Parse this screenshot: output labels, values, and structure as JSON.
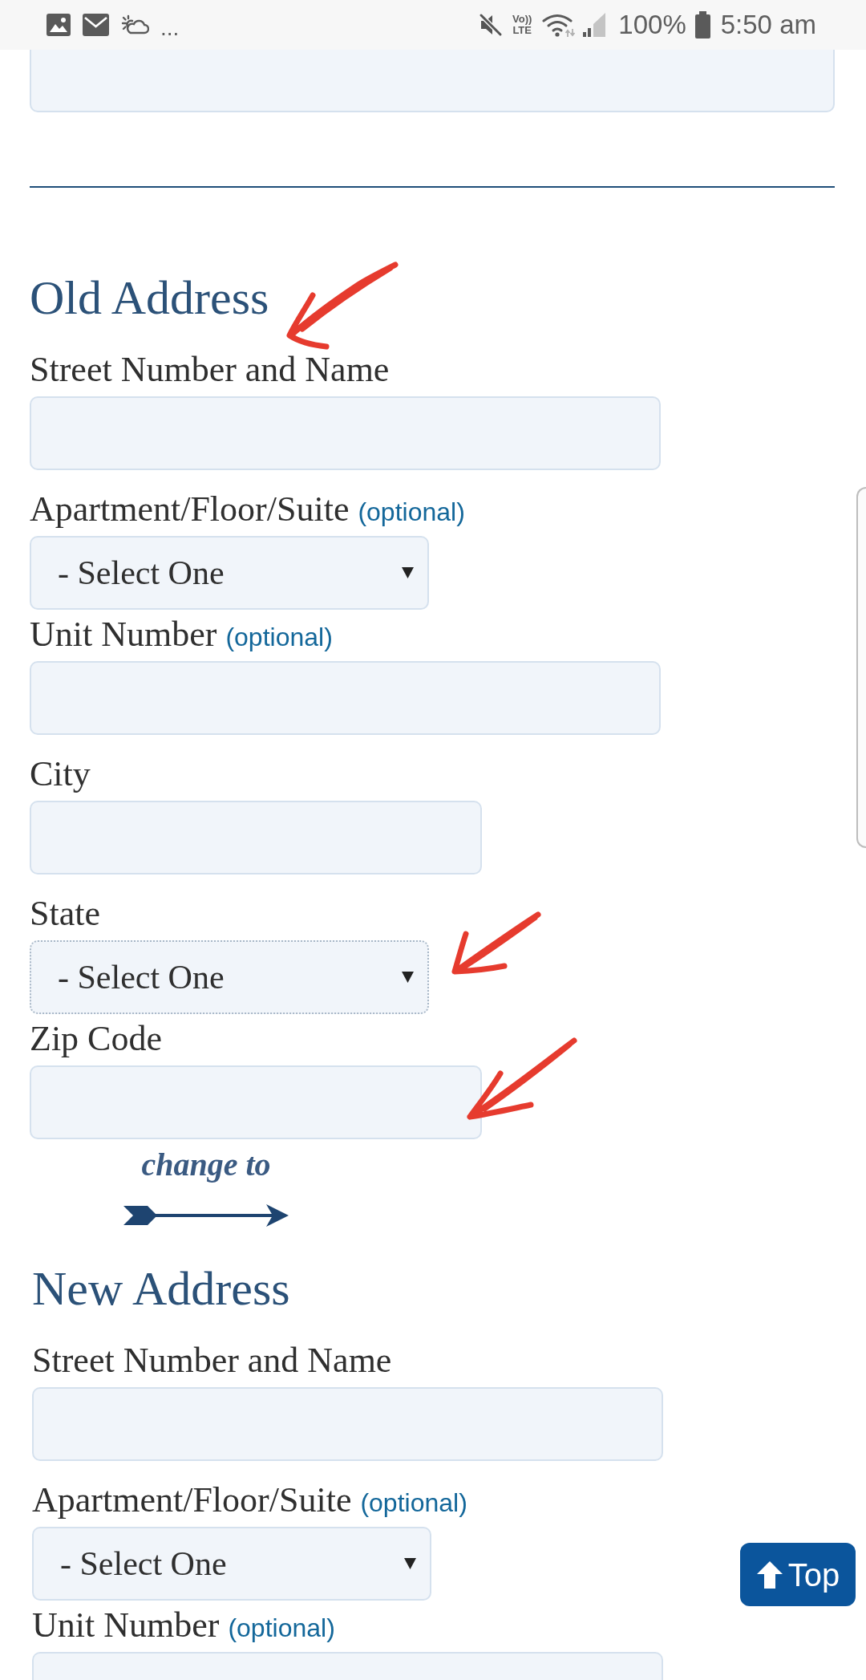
{
  "status_bar": {
    "more": "...",
    "volte": "Vo))",
    "network": "LTE",
    "battery": "100%",
    "time": "5:50 am"
  },
  "leading_field": {
    "kind": "textarea",
    "focused": false
  },
  "sections": [
    {
      "kind": "address",
      "title": "Old Address",
      "title_marked": true,
      "fields": [
        {
          "kind": "text",
          "label": "Street Number and Name",
          "focused": false,
          "marked": false
        },
        {
          "kind": "select",
          "label": "Apartment/Floor/Suite",
          "note": "(optional)",
          "value": "- Select One",
          "focused": false,
          "marked": false
        },
        {
          "kind": "text",
          "label": "Unit Number",
          "note": "(optional)",
          "focused": false,
          "marked": false
        },
        {
          "kind": "text",
          "label": "City",
          "focused": false,
          "marked": false
        },
        {
          "kind": "select",
          "label": "State",
          "value": "- Select One",
          "focused": true,
          "marked": true
        },
        {
          "kind": "text",
          "label": "Zip Code",
          "focused": false,
          "marked": true
        }
      ]
    },
    {
      "kind": "transition",
      "text": "change to"
    },
    {
      "kind": "address",
      "title": "New Address",
      "title_marked": false,
      "fields": [
        {
          "kind": "text",
          "label": "Street Number and Name",
          "focused": false,
          "marked": false
        },
        {
          "kind": "select",
          "label": "Apartment/Floor/Suite",
          "note": "(optional)",
          "value": "- Select One",
          "focused": false,
          "marked": false
        },
        {
          "kind": "text",
          "label": "Unit Number",
          "note": "(optional)",
          "focused": false,
          "marked": false
        }
      ]
    }
  ],
  "top_button": {
    "label": "Top"
  }
}
